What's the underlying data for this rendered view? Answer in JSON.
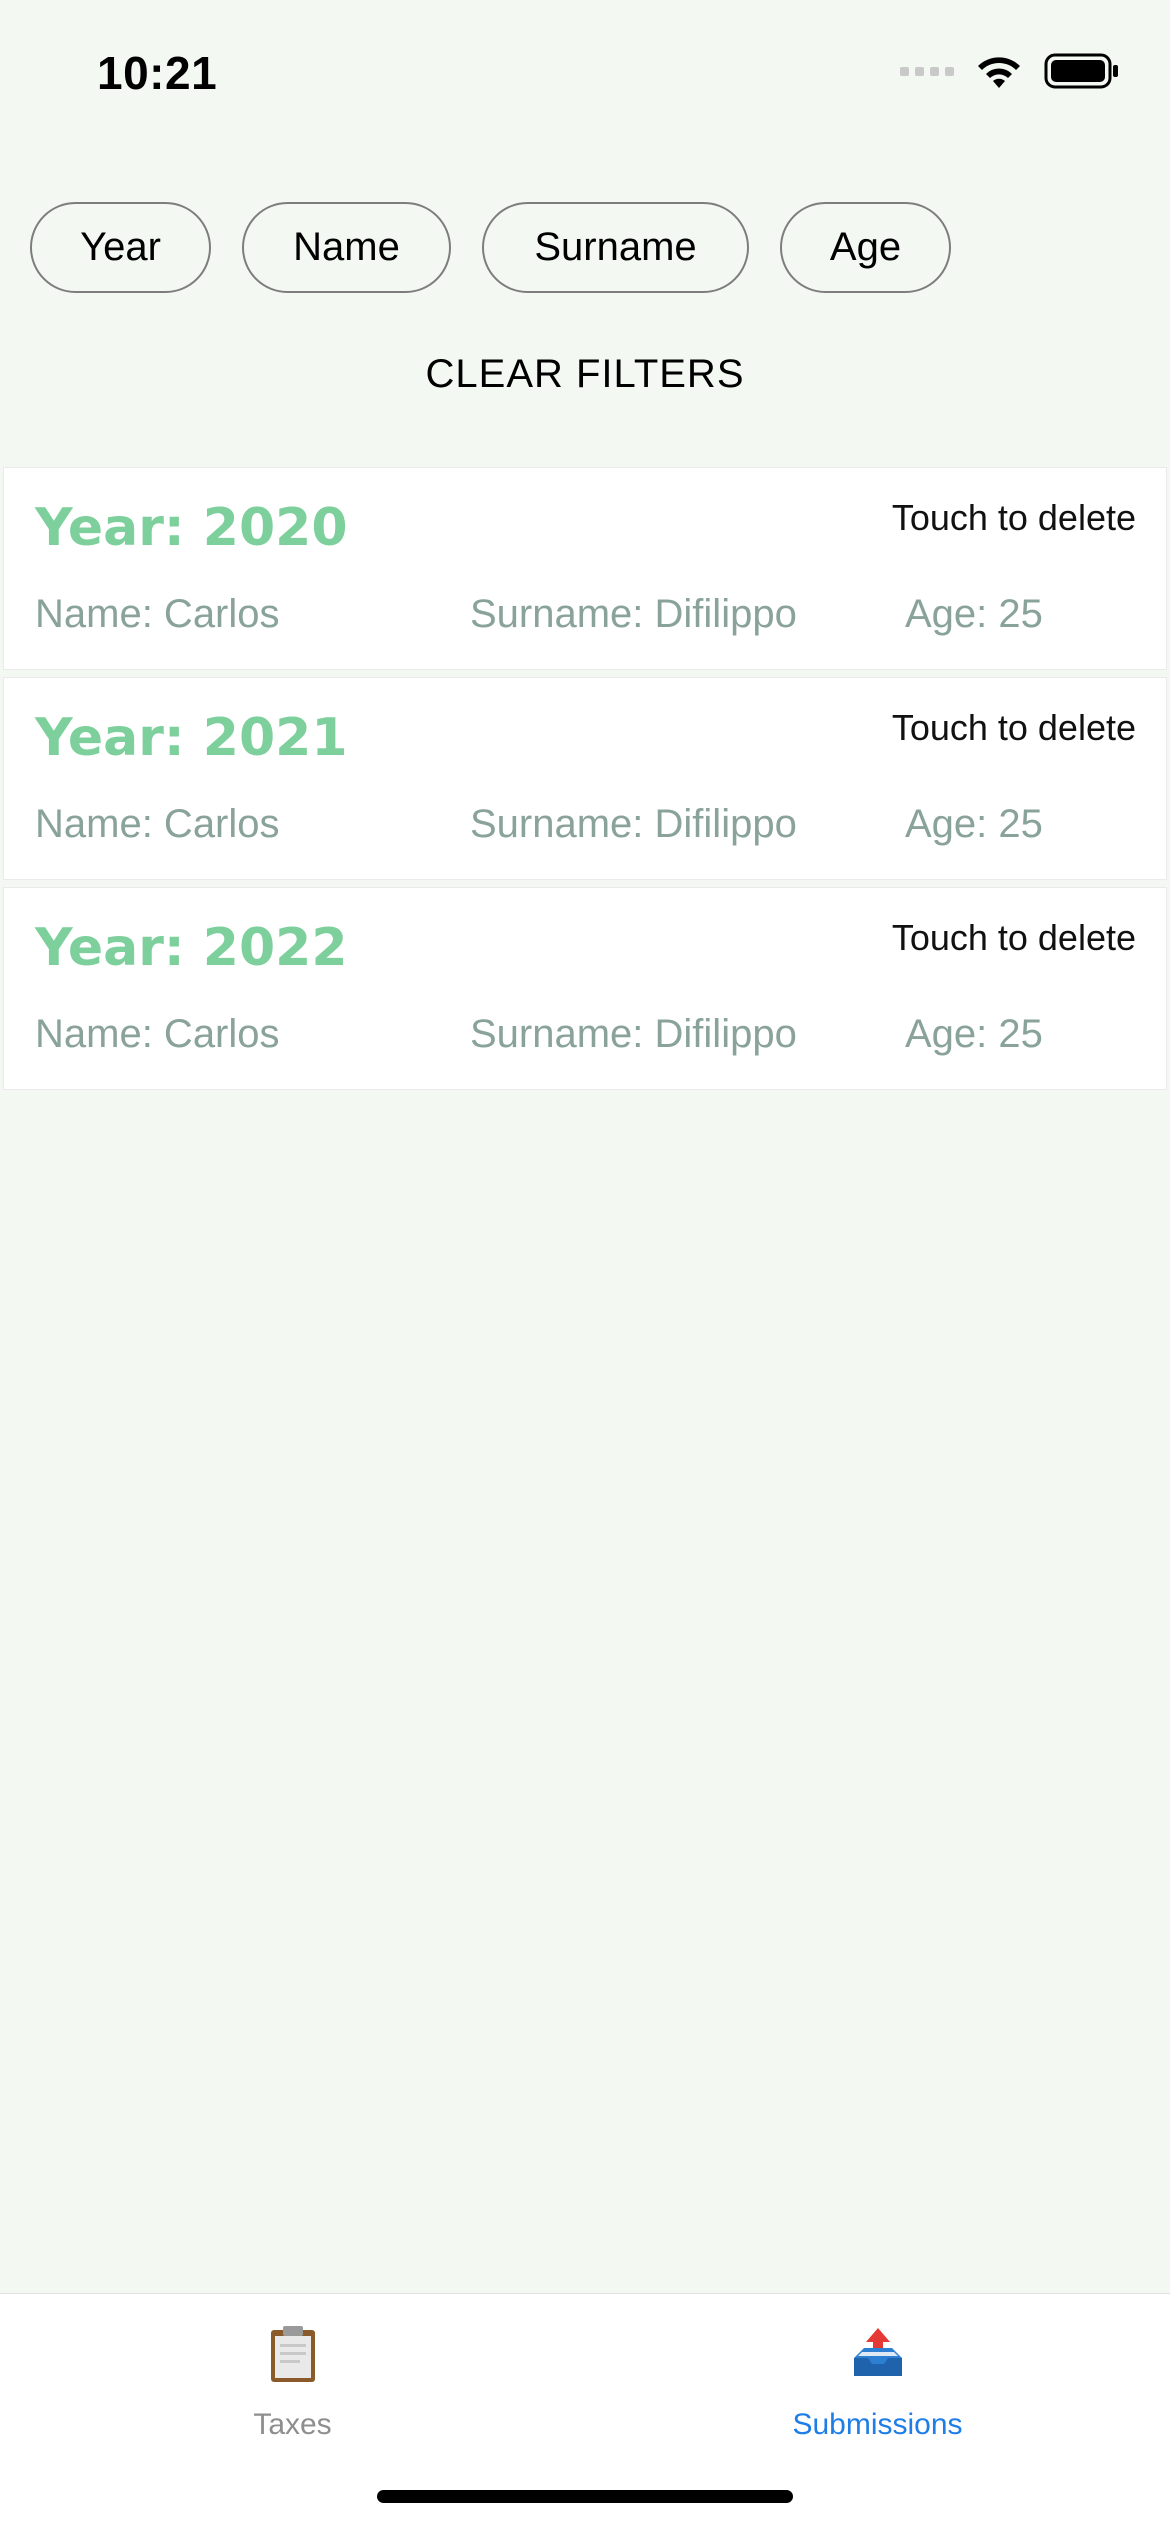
{
  "status_bar": {
    "time": "10:21"
  },
  "filters": {
    "chips": [
      "Year",
      "Name",
      "Surname",
      "Age"
    ],
    "clear_label": "CLEAR FILTERS"
  },
  "submissions": [
    {
      "year": "Year: 2020",
      "delete_label": "Touch to delete",
      "name": "Name: Carlos",
      "surname": "Surname: Difilippo",
      "age": "Age: 25"
    },
    {
      "year": "Year: 2021",
      "delete_label": "Touch to delete",
      "name": "Name: Carlos",
      "surname": "Surname: Difilippo",
      "age": "Age: 25"
    },
    {
      "year": "Year: 2022",
      "delete_label": "Touch to delete",
      "name": "Name: Carlos",
      "surname": "Surname: Difilippo",
      "age": "Age: 25"
    }
  ],
  "tab_bar": {
    "tabs": [
      {
        "label": "Taxes",
        "icon": "clipboard-icon",
        "active": false
      },
      {
        "label": "Submissions",
        "icon": "outbox-tray-icon",
        "active": true
      }
    ]
  },
  "colors": {
    "background": "#f3f8f2",
    "year_green": "#7dcf9c",
    "field_gray_green": "#8aa39a",
    "active_tab_blue": "#1e7de6"
  }
}
